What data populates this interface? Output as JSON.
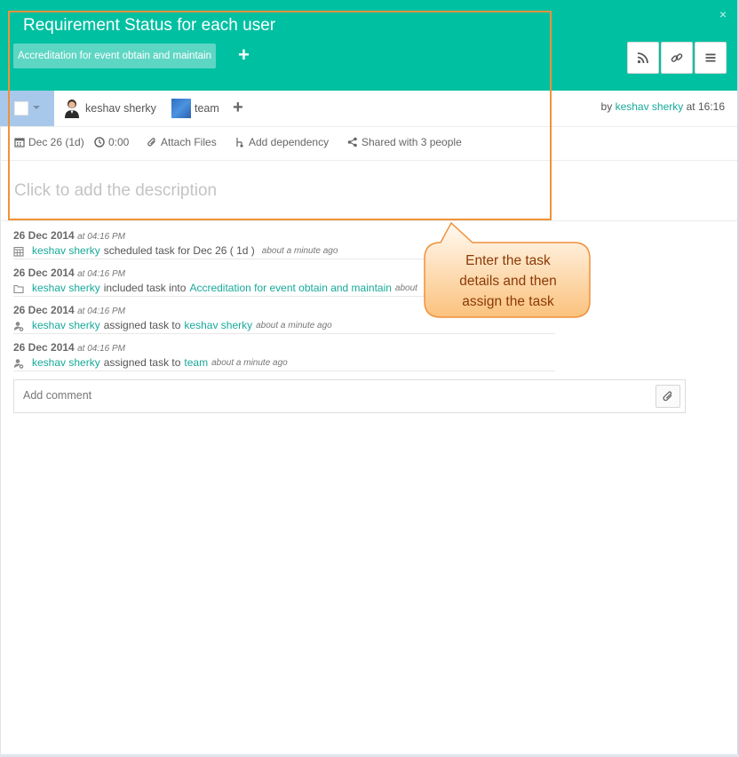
{
  "header": {
    "title": "Requirement Status for each user",
    "tag": "Accreditation for event obtain and maintain",
    "add_tag": "+",
    "close": "×",
    "icons": [
      "rss-icon",
      "link-icon",
      "menu-icon"
    ]
  },
  "assignees": {
    "user": "keshav sherky",
    "team": "team",
    "add": "+"
  },
  "byline": {
    "prefix": "by",
    "author": "keshav sherky",
    "time": "at 16:16"
  },
  "meta": {
    "date": "Dec 26 (1d)",
    "time": "0:00",
    "attach": "Attach Files",
    "dependency": "Add dependency",
    "shared": "Shared with 3 people"
  },
  "description_placeholder": "Click to add the description",
  "activity": [
    {
      "date": "26 Dec 2014",
      "time": "at 04:16 PM",
      "user": "keshav sherky",
      "action": "scheduled task for Dec 26 ( 1d )",
      "target": "",
      "ago": "about a minute ago"
    },
    {
      "date": "26 Dec 2014",
      "time": "at 04:16 PM",
      "user": "keshav sherky",
      "action": "included task into",
      "target": "Accreditation for event obtain and maintain",
      "ago": "about"
    },
    {
      "date": "26 Dec 2014",
      "time": "at 04:16 PM",
      "user": "keshav sherky",
      "action": "assigned task to",
      "target": "keshav sherky",
      "ago": "about a minute ago"
    },
    {
      "date": "26 Dec 2014",
      "time": "at 04:16 PM",
      "user": "keshav sherky",
      "action": "assigned task to",
      "target": "team",
      "ago": "about a minute ago"
    }
  ],
  "comment": {
    "placeholder": "Add comment"
  },
  "callout": {
    "line1": "Enter the task",
    "line2": "details and then",
    "line3": "assign the task"
  },
  "colors": {
    "header_bg": "#00c0a2",
    "link": "#17a99a",
    "highlight": "#f0913b"
  }
}
